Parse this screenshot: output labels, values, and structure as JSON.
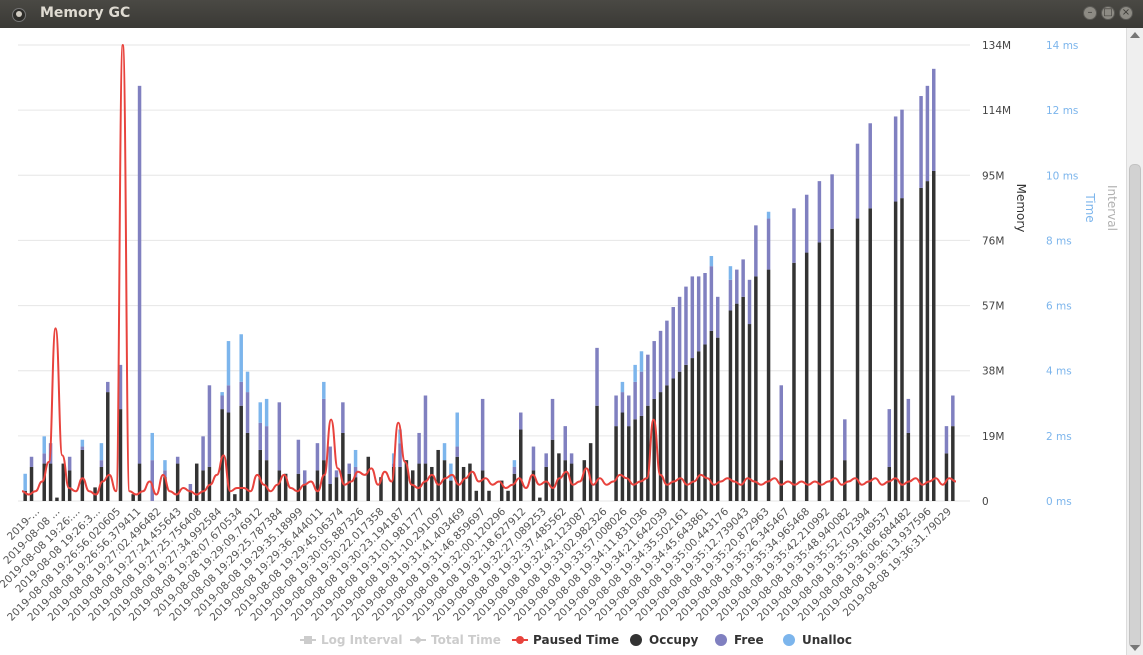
{
  "window": {
    "title": "Memory GC",
    "icons": [
      "app-icon",
      "minimize-icon",
      "maximize-icon",
      "close-icon"
    ]
  },
  "chart_data": {
    "type": "bar",
    "stacked": true,
    "title": "",
    "ylabel": "Memory",
    "y2label": "Time",
    "y3label": "Interval",
    "ylim": [
      0,
      134
    ],
    "y_ticks": [
      "0",
      "19M",
      "38M",
      "57M",
      "76M",
      "95M",
      "114M",
      "134M"
    ],
    "y2lim": [
      0,
      14
    ],
    "y2_ticks": [
      "0 ms",
      "2 ms",
      "4 ms",
      "6 ms",
      "8 ms",
      "10 ms",
      "12 ms",
      "14 ms"
    ],
    "x_tick_labels": [
      "2019-...",
      "2019-08-08 ...",
      "2019-08-08 19:26:...",
      "2019-08-08 19:26:3...",
      "2019-08-08 19:26:56.020605",
      "2019-08-08 19:26:56.379411",
      "2019-08-08 19:27:02.496482",
      "2019-08-08 19:27:24.455643",
      "2019-08-08 19:27:25.756408",
      "2019-08-08 19:27:34.992584",
      "2019-08-08 19:28:07.670534",
      "2019-08-08 19:29:09.76912",
      "2019-08-08 19:29:25.787384",
      "2019-08-08 19:29:35.18999",
      "2019-08-08 19:29:36.444011",
      "2019-08-08 19:29:45.06374",
      "2019-08-08 19:30:05.887326",
      "2019-08-08 19:30:22.017358",
      "2019-08-08 19:30:23.194187",
      "2019-08-08 19:31:01.981777",
      "2019-08-08 19:31:10.291097",
      "2019-08-08 19:31:41.403469",
      "2019-08-08 19:31:46.859697",
      "2019-08-08 19:32:00.120296",
      "2019-08-08 19:32:18.627912",
      "2019-08-08 19:32:27.089253",
      "2019-08-08 19:32:37.485562",
      "2019-08-08 19:32:42.123087",
      "2019-08-08 19:33:02.982326",
      "2019-08-08 19:33:57.008026",
      "2019-08-08 19:34:11.831036",
      "2019-08-08 19:34:21.642039",
      "2019-08-08 19:34:35.502161",
      "2019-08-08 19:34:45.643861",
      "2019-08-08 19:35:00.443176",
      "2019-08-08 19:35:12.739043",
      "2019-08-08 19:35:20.872963",
      "2019-08-08 19:35:26.345467",
      "2019-08-08 19:35:34.965468",
      "2019-08-08 19:35:42.210992",
      "2019-08-08 19:35:48.940082",
      "2019-08-08 19:35:52.702394",
      "2019-08-08 19:35:59.189537",
      "2019-08-08 19:36:06.684482",
      "2019-08-08 19:36:13.937596",
      "2019-08-08 19:36:31.79029"
    ],
    "legend_position": "bottom",
    "legend": [
      {
        "name": "Log Interval",
        "color": "#cccccc",
        "marker": "square",
        "enabled": false
      },
      {
        "name": "Total Time",
        "color": "#cccccc",
        "marker": "diamond",
        "enabled": false
      },
      {
        "name": "Paused Time",
        "color": "#e8433d",
        "marker": "line",
        "enabled": true
      },
      {
        "name": "Occupy",
        "color": "#333333",
        "marker": "dot",
        "enabled": true
      },
      {
        "name": "Free",
        "color": "#8080c0",
        "marker": "dot",
        "enabled": true
      },
      {
        "name": "Unalloc",
        "color": "#7cb5ec",
        "marker": "dot",
        "enabled": true
      }
    ],
    "series": [
      {
        "name": "Occupy",
        "color": "#333333",
        "values": [
          3,
          10,
          0,
          11,
          11,
          1,
          11,
          9,
          0,
          15,
          0,
          4,
          10,
          32,
          0,
          27,
          0,
          2,
          11,
          0,
          0,
          0,
          7,
          0,
          11,
          0,
          3,
          11,
          9,
          10,
          0,
          27,
          26,
          2,
          28,
          20,
          0,
          15,
          12,
          0,
          9,
          8,
          0,
          8,
          5,
          0,
          9,
          12,
          5,
          7,
          20,
          8,
          7,
          0,
          13,
          0,
          7,
          0,
          10,
          10,
          12,
          9,
          11,
          11,
          10,
          15,
          12,
          6,
          13,
          10,
          11,
          3,
          9,
          3,
          0,
          6,
          3,
          8,
          21,
          0,
          9,
          1,
          10,
          18,
          14,
          12,
          11,
          0,
          12,
          17,
          28,
          0,
          0,
          22,
          26,
          22,
          24,
          25,
          28,
          30,
          32,
          34,
          36,
          38,
          40,
          42,
          44,
          46,
          50,
          48,
          0,
          56,
          58,
          60,
          52,
          66,
          0,
          68,
          0,
          12,
          0,
          70,
          0,
          73,
          0,
          76,
          0,
          80,
          0,
          12,
          0,
          83,
          0,
          86,
          0,
          0,
          10,
          88,
          89,
          20,
          0,
          92,
          94,
          97,
          0,
          14,
          22
        ]
      },
      {
        "name": "Free",
        "color": "#8080c0",
        "values": [
          0,
          3,
          0,
          3,
          6,
          0,
          0,
          4,
          0,
          1,
          0,
          0,
          2,
          3,
          0,
          13,
          0,
          0,
          111,
          0,
          12,
          0,
          2,
          0,
          2,
          0,
          2,
          0,
          10,
          24,
          0,
          4,
          8,
          0,
          7,
          12,
          0,
          8,
          10,
          0,
          20,
          0,
          0,
          10,
          4,
          0,
          8,
          18,
          11,
          2,
          9,
          3,
          3,
          0,
          0,
          0,
          0,
          0,
          1,
          7,
          0,
          0,
          9,
          20,
          0,
          0,
          0,
          0,
          3,
          0,
          0,
          0,
          21,
          0,
          0,
          0,
          0,
          2,
          5,
          0,
          7,
          0,
          4,
          12,
          0,
          10,
          3,
          0,
          0,
          0,
          17,
          0,
          0,
          9,
          6,
          9,
          11,
          13,
          15,
          17,
          18,
          19,
          21,
          22,
          23,
          24,
          22,
          21,
          19,
          12,
          0,
          9,
          10,
          11,
          13,
          15,
          0,
          15,
          0,
          22,
          0,
          16,
          0,
          17,
          0,
          18,
          0,
          16,
          0,
          12,
          0,
          22,
          0,
          25,
          0,
          0,
          17,
          25,
          26,
          10,
          0,
          27,
          28,
          30,
          0,
          8,
          9
        ]
      },
      {
        "name": "Unalloc",
        "color": "#7cb5ec",
        "values": [
          5,
          0,
          0,
          5,
          0,
          0,
          0,
          0,
          0,
          2,
          0,
          0,
          5,
          0,
          0,
          0,
          0,
          0,
          0,
          0,
          8,
          0,
          3,
          0,
          0,
          0,
          0,
          0,
          0,
          0,
          0,
          1,
          13,
          0,
          14,
          6,
          0,
          6,
          8,
          0,
          0,
          0,
          0,
          0,
          0,
          0,
          0,
          5,
          0,
          0,
          0,
          0,
          5,
          0,
          0,
          0,
          0,
          0,
          3,
          4,
          0,
          0,
          0,
          0,
          0,
          0,
          5,
          5,
          10,
          0,
          0,
          0,
          0,
          0,
          0,
          0,
          0,
          2,
          0,
          0,
          0,
          0,
          0,
          0,
          0,
          0,
          0,
          0,
          0,
          0,
          0,
          0,
          0,
          0,
          3,
          0,
          5,
          6,
          0,
          0,
          0,
          0,
          0,
          0,
          0,
          0,
          0,
          0,
          3,
          0,
          0,
          4,
          0,
          0,
          0,
          0,
          0,
          2,
          0,
          0,
          0,
          0,
          0,
          0,
          0,
          0,
          0,
          0,
          0,
          0,
          0,
          0,
          0,
          0,
          0,
          0,
          0,
          0,
          0,
          0,
          0,
          0,
          0,
          0,
          0,
          0,
          0
        ]
      },
      {
        "name": "Paused Time",
        "color": "#e8433d",
        "axis": "time_ms",
        "values": [
          0.3,
          0.2,
          0.3,
          0.6,
          1.2,
          5.3,
          1.4,
          0.4,
          0.3,
          0.7,
          0.3,
          0.2,
          0.6,
          0.8,
          0.3,
          14,
          0.3,
          0.2,
          0.3,
          0.6,
          0.2,
          0.8,
          0.3,
          0.2,
          0.4,
          0.3,
          0.2,
          0.3,
          0.5,
          0.8,
          1.4,
          0.3,
          0.4,
          0.4,
          0.3,
          0.8,
          0.5,
          0.3,
          0.5,
          0.8,
          0.4,
          0.3,
          0.5,
          0.6,
          0.3,
          0.8,
          2.5,
          1.0,
          0.5,
          0.6,
          0.9,
          0.8,
          1.0,
          0.5,
          0.9,
          0.6,
          2.4,
          1.2,
          0.5,
          0.4,
          0.6,
          0.8,
          0.5,
          0.7,
          0.8,
          0.5,
          0.7,
          0.9,
          0.6,
          0.7,
          0.5,
          0.6,
          0.4,
          0.5,
          0.7,
          0.4,
          0.8,
          0.5,
          0.6,
          0.4,
          0.7,
          0.9,
          0.5,
          0.6,
          1.0,
          0.5,
          0.7,
          0.5,
          0.6,
          0.8,
          0.7,
          0.5,
          0.6,
          0.7,
          2.5,
          0.8,
          0.5,
          0.6,
          0.7,
          0.5,
          0.6,
          0.8,
          0.7,
          0.5,
          0.6,
          0.7,
          0.6,
          0.5,
          0.7,
          0.6,
          0.5,
          0.6,
          0.7,
          0.5,
          0.6,
          0.5,
          0.6,
          0.5,
          0.6,
          0.5,
          0.6,
          0.7,
          0.5,
          0.6,
          0.7,
          0.5,
          0.6,
          0.7,
          0.5,
          0.6,
          0.7,
          0.5,
          0.6,
          0.7,
          0.5,
          0.6,
          0.7,
          0.5,
          0.7,
          0.6
        ]
      }
    ]
  }
}
